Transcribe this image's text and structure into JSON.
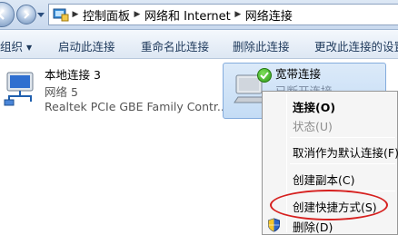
{
  "address": {
    "crumbs": [
      "控制面板",
      "网络和 Internet",
      "网络连接"
    ]
  },
  "toolbar": {
    "organize": "组织",
    "connect": "启动此连接",
    "rename": "重命名此连接",
    "delete": "删除此连接",
    "change_settings": "更改此连接的设置"
  },
  "connections": [
    {
      "name": "本地连接 3",
      "network": "网络  5",
      "adapter": "Realtek PCIe GBE Family Contr..."
    },
    {
      "name": "宽带连接",
      "status": "已断开连接"
    }
  ],
  "context_menu": {
    "items": [
      {
        "label": "连接(O)",
        "style": "bold"
      },
      {
        "label": "状态(U)",
        "style": "disabled"
      },
      {
        "label": "取消作为默认连接(F)",
        "style": "normal"
      },
      {
        "label": "创建副本(C)",
        "style": "normal"
      },
      {
        "label": "创建快捷方式(S)",
        "style": "normal"
      },
      {
        "label": "删除(D)",
        "style": "normal",
        "icon": "uac-shield-icon"
      }
    ]
  },
  "colors": {
    "highlight_ellipse": "#d6201f",
    "selection": "#c4dcf5",
    "toolbar_text": "#1e395b"
  }
}
